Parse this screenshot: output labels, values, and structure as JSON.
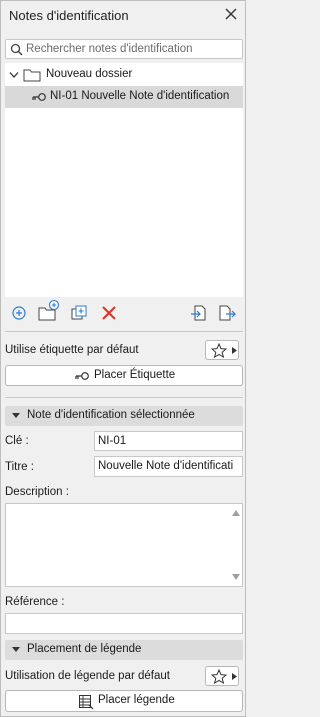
{
  "window": {
    "title": "Notes d'identification"
  },
  "search": {
    "placeholder": "Rechercher notes d'identification"
  },
  "tree": {
    "folder": "Nouveau dossier",
    "note": "NI-01 Nouvelle Note d'identification"
  },
  "default_label": {
    "text": "Utilise étiquette par défaut",
    "place_button": "Placer Étiquette"
  },
  "selected_section": {
    "title": "Note d'identification sélectionnée",
    "key_label": "Clé :",
    "key_value": "NI-01",
    "title_label": "Titre :",
    "title_value": "Nouvelle Note d'identificati",
    "description_label": "Description :",
    "reference_label": "Référence :"
  },
  "legend_section": {
    "title": "Placement de légende",
    "default_text": "Utilisation de légende par défaut",
    "place_button": "Placer légende"
  },
  "colors": {
    "delete": "#e0301e",
    "accent": "#2a7bd6"
  }
}
